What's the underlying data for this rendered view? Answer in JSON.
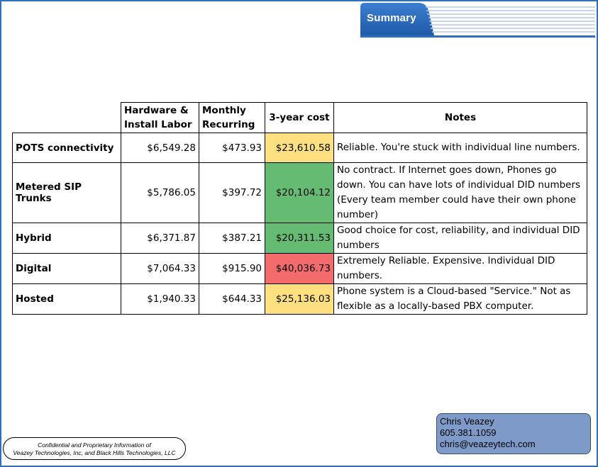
{
  "header": {
    "title": "Summary"
  },
  "table": {
    "columns": [
      "",
      "Hardware & Install Labor",
      "Monthly Recurring",
      "3-year cost",
      "Notes"
    ],
    "rows": [
      {
        "name": "POTS connectivity",
        "hardware": "$6,549.28",
        "monthly": "$473.93",
        "three_year": "$23,610.58",
        "highlight": "#ffe080",
        "notes": "Reliable.  You're stuck with individual line numbers."
      },
      {
        "name": "Metered SIP Trunks",
        "hardware": "$5,786.05",
        "monthly": "$397.72",
        "three_year": "$20,104.12",
        "highlight": "#66bb72",
        "notes": "No contract.  If Internet goes down, Phones go down.  You can have lots of individual DID numbers (Every team member could have their own phone number)"
      },
      {
        "name": "Hybrid",
        "hardware": "$6,371.87",
        "monthly": "$387.21",
        "three_year": "$20,311.53",
        "highlight": "#66bb72",
        "notes": "Good choice for cost, reliability, and individual DID numbers"
      },
      {
        "name": "Digital",
        "hardware": "$7,064.33",
        "monthly": "$915.90",
        "three_year": "$40,036.73",
        "highlight": "#f36b6b",
        "notes": "Extremely Reliable.  Expensive.  Individual DID numbers."
      },
      {
        "name": "Hosted",
        "hardware": "$1,940.33",
        "monthly": "$644.33",
        "three_year": "$25,136.03",
        "highlight": "#ffe080",
        "notes": "Phone system is a Cloud-based \"Service.\"  Not as flexible as a locally-based PBX computer."
      }
    ]
  },
  "footer": {
    "confidential_line1": "Confidential and Proprietary Information of",
    "confidential_line2": "Veazey Technologies, Inc, and Black Hills Technologies, LLC",
    "contact_name": "Chris Veazey",
    "contact_phone": "605.381.1059",
    "contact_email": "chris@veazeytech.com"
  },
  "colors": {
    "accent": "#2f6fbd",
    "yellow": "#ffe080",
    "green": "#66bb72",
    "red": "#f36b6b"
  }
}
